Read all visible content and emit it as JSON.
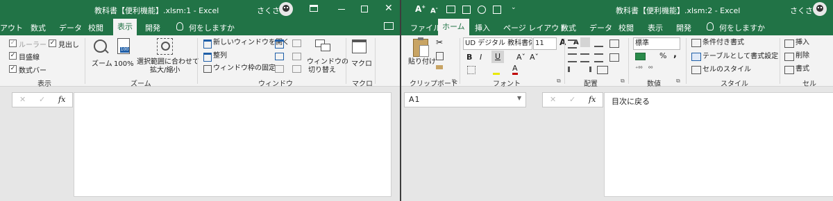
{
  "left": {
    "title": "教科書【便利機能】.xlsm:1  -  Excel",
    "user": "さくさく",
    "tabs": [
      "アウト",
      "数式",
      "データ",
      "校閲",
      "表示",
      "開発"
    ],
    "active_tab": "表示",
    "tell_me": "何をしますか",
    "groups": {
      "view": {
        "label": "表示",
        "ruler": "ルーラー",
        "gridlines": "目盛線",
        "formula_bar": "数式バー",
        "headings": "見出し"
      },
      "zoom": {
        "label": "ズーム",
        "zoom": "ズーム",
        "zoom100": "100%",
        "zoom_selection_1": "選択範囲に合わせて",
        "zoom_selection_2": "拡大/縮小",
        "pct_badge": "100"
      },
      "window": {
        "label": "ウィンドウ",
        "new_window": "新しいウィンドウを開く",
        "arrange": "整列",
        "freeze": "ウィンドウ枠の固定",
        "switch_1": "ウィンドウの",
        "switch_2": "切り替え"
      },
      "macro": {
        "label": "マクロ",
        "macro": "マクロ"
      }
    },
    "formula_fx": "fx"
  },
  "right": {
    "title": "教科書【便利機能】.xlsm:2  -  Excel",
    "user": "さくさく",
    "tabs": [
      "ファイル",
      "ホーム",
      "挿入",
      "ページ レイアウト",
      "数式",
      "データ",
      "校閲",
      "表示",
      "開発"
    ],
    "active_tab": "ホーム",
    "tell_me": "何をしますか",
    "groups": {
      "clipboard": {
        "label": "クリップボード",
        "paste": "貼り付け"
      },
      "font": {
        "label": "フォント",
        "font_name": "UD デジタル 教科書体",
        "font_size": "11",
        "bold": "B",
        "italic": "I",
        "underline": "U",
        "grow": "A",
        "shrink": "A"
      },
      "alignment": {
        "label": "配置"
      },
      "number": {
        "label": "数値",
        "format": "標準",
        "percent": "%",
        "comma": ","
      },
      "styles": {
        "label": "スタイル",
        "conditional": "条件付き書式",
        "table": "テーブルとして書式設定",
        "cell_styles": "セルのスタイル"
      },
      "cells": {
        "label": "セル",
        "insert": "挿入",
        "delete": "削除",
        "format": "書式"
      }
    },
    "name_box": "A1",
    "formula_fx": "fx",
    "formula_value": "目次に戻る"
  },
  "colors": {
    "excel_green": "#217346",
    "ribbon_bg": "#f3f3f3"
  }
}
